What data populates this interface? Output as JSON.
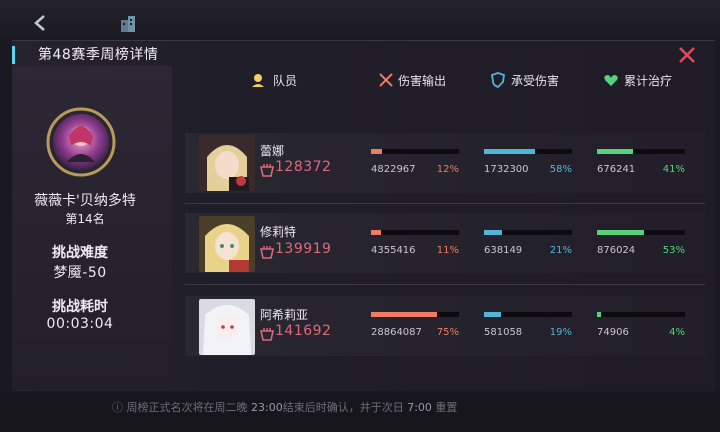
{
  "title": "第48赛季周榜详情",
  "leader": {
    "name": "薇薇卡'贝纳多特",
    "rank": "第14名",
    "difficulty_label": "挑战难度",
    "difficulty_value": "梦魇-50",
    "time_label": "挑战耗时",
    "time_value": "00:03:04"
  },
  "headers": {
    "member": "队员",
    "damage": "伤害输出",
    "taken": "承受伤害",
    "heal": "累计治疗"
  },
  "rows": [
    {
      "name": "蕾娜",
      "power": "128372",
      "damage": "4822967",
      "damage_pct": "12%",
      "damage_frac": 0.12,
      "taken": "1732300",
      "taken_pct": "58%",
      "taken_frac": 0.58,
      "heal": "676241",
      "heal_pct": "41%",
      "heal_frac": 0.41
    },
    {
      "name": "修莉特",
      "power": "139919",
      "damage": "4355416",
      "damage_pct": "11%",
      "damage_frac": 0.11,
      "taken": "638149",
      "taken_pct": "21%",
      "taken_frac": 0.21,
      "heal": "876024",
      "heal_pct": "53%",
      "heal_frac": 0.53
    },
    {
      "name": "阿希莉亚",
      "power": "141692",
      "damage": "28864087",
      "damage_pct": "75%",
      "damage_frac": 0.75,
      "taken": "581058",
      "taken_pct": "19%",
      "taken_frac": 0.19,
      "heal": "74906",
      "heal_pct": "4%",
      "heal_frac": 0.04
    }
  ],
  "footer": {
    "prefix": "周榜正式名次将在周二晚 ",
    "time1": "23:00",
    "mid": "结束后时确认，并于次日 ",
    "time2": "7:00",
    "suffix": " 重置"
  },
  "colors": {
    "damage": "#f07a62",
    "taken": "#4fb6d8",
    "heal": "#58d27a",
    "power": "#e3677a",
    "accent": "#5fd3f0"
  },
  "icons": [
    "back-arrow-icon",
    "building-icon",
    "close-x-icon",
    "member-icon",
    "sword-icon",
    "shield-icon",
    "heart-icon",
    "power-icon"
  ]
}
